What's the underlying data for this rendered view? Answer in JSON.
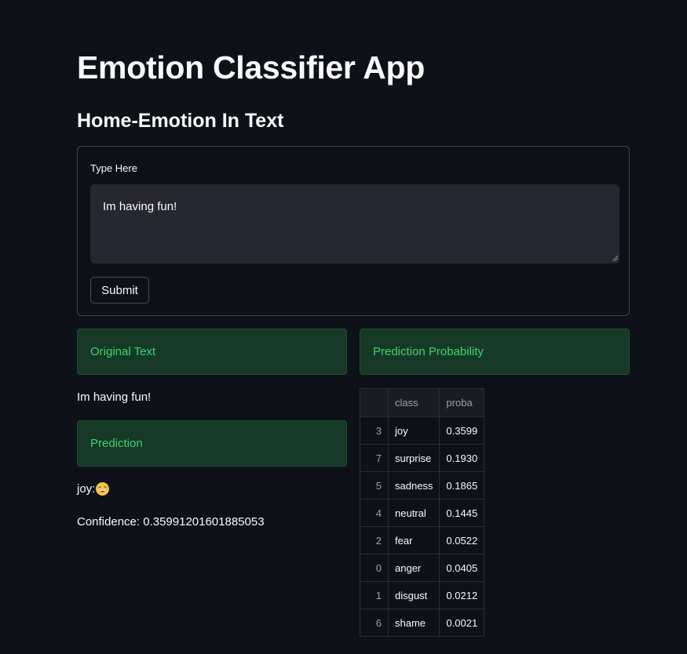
{
  "title": "Emotion Classifier App",
  "subheader": "Home-Emotion In Text",
  "form": {
    "label": "Type Here",
    "text_value": "Im having fun!",
    "submit_label": "Submit"
  },
  "results": {
    "original_text_header": "Original Text",
    "original_text": "Im having fun!",
    "prediction_header": "Prediction",
    "prediction_label": "joy:",
    "prediction_emoji": "grinning-face-icon",
    "confidence": "Confidence: 0.35991201601885053",
    "probability_header": "Prediction Probability"
  },
  "table": {
    "columns": [
      "",
      "class",
      "proba"
    ],
    "rows": [
      {
        "index": "3",
        "class": "joy",
        "proba": "0.3599"
      },
      {
        "index": "7",
        "class": "surprise",
        "proba": "0.1930"
      },
      {
        "index": "5",
        "class": "sadness",
        "proba": "0.1865"
      },
      {
        "index": "4",
        "class": "neutral",
        "proba": "0.1445"
      },
      {
        "index": "2",
        "class": "fear",
        "proba": "0.0522"
      },
      {
        "index": "0",
        "class": "anger",
        "proba": "0.0405"
      },
      {
        "index": "1",
        "class": "disgust",
        "proba": "0.0212"
      },
      {
        "index": "6",
        "class": "shame",
        "proba": "0.0021"
      }
    ]
  },
  "colors": {
    "background": "#0e1117",
    "callout_bg": "#173928",
    "callout_text": "#3dd56d",
    "input_bg": "#262730"
  }
}
